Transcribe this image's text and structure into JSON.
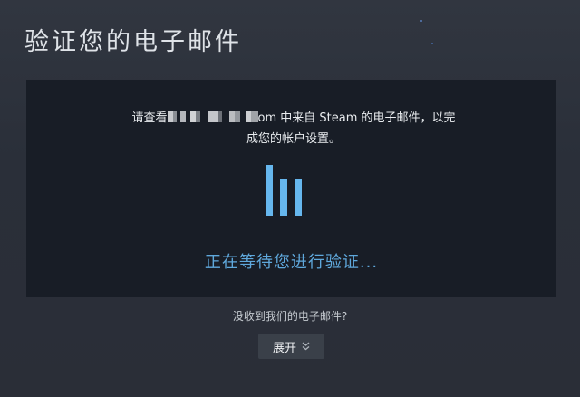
{
  "page": {
    "title": "验证您的电子邮件"
  },
  "panel": {
    "message_prefix": "请查看",
    "message_email_suffix": "om",
    "message_rest": " 中来自 Steam 的电子邮件，以完",
    "message_line2": "成您的帐户设置。",
    "waiting_text": "正在等待您进行验证..."
  },
  "footer": {
    "no_email_text": "没收到我们的电子邮件?",
    "expand_label": "展开"
  },
  "icons": {
    "loader": "steam-loading-bars-icon",
    "expand": "double-chevron-down-icon"
  },
  "colors": {
    "accent": "#66b7ee",
    "waiting_text": "#5fa8dc",
    "panel_bg": "#181d26",
    "page_bg": "#2b303a"
  }
}
